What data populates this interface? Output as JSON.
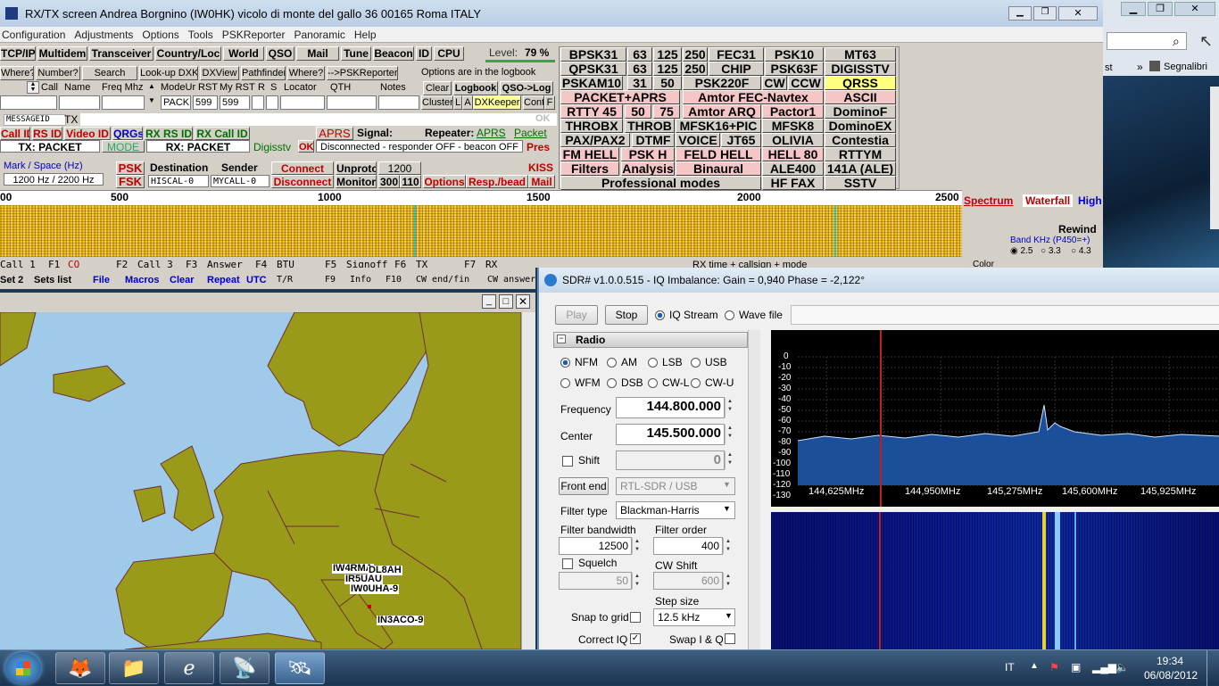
{
  "mixw": {
    "title": "RX/TX screen  Andrea Borgnino (IW0HK)     vicolo di monte del gallo 36     00165 Roma     ITALY",
    "menu": [
      "Configuration",
      "Adjustments",
      "Options",
      "Tools",
      "PSKReporter",
      "Panoramic",
      "Help"
    ],
    "toolbar1": [
      "TCP/IP",
      "Multidem",
      "Transceiver",
      "Country/Loc",
      "World",
      "QSO",
      "Mail",
      "Tune",
      "Beacon",
      "ID",
      "CPU"
    ],
    "level_label": "Level:",
    "level_value": "79 %",
    "toolbar2": [
      "Where?",
      "Number?",
      "Search",
      "Look-up DXK",
      "DXView",
      "Pathfinder",
      "Where?",
      "-->PSKReporter"
    ],
    "logbook_note": "Options are in the logbook",
    "log_headers": [
      "Call",
      "Name",
      "Freq Mhz",
      "ModeUr",
      "RST",
      "My RST",
      "R",
      "S",
      "Locator",
      "QTH",
      "Notes"
    ],
    "log_values": {
      "mode": "PACK",
      "rst": "599",
      "myrst": "599"
    },
    "log_buttons": {
      "clear": "Clear",
      "logbook": "Logbook",
      "qso_log": "QSO->Log",
      "cluster": "Cluster",
      "l": "L",
      "a": "A",
      "dxkeeper": "DXKeeper",
      "cont": "Cont",
      "f": "F"
    },
    "msg_field": "MESSAGEID",
    "tx_label": "TX",
    "ok_label": "OK",
    "id_row": [
      "Call ID",
      "RS ID",
      "Video ID",
      "QRGs",
      "RX RS ID",
      "RX Call ID",
      "APRS"
    ],
    "signal_label": "Signal:",
    "repeater_label": "Repeater:",
    "aprs_link": "APRS",
    "packet_link": "Packet",
    "tx_mode": "TX: PACKET",
    "mode_btn": "MODE",
    "rx_mode": "RX: PACKET",
    "digisstv": "Digisstv",
    "ok2": "OK",
    "status": "Disconnected - responder OFF - beacon OFF",
    "pres": "Pres",
    "mark_space_label": "Mark / Space (Hz)",
    "mark_space_value": "1200 Hz / 2200 Hz",
    "psk": "PSK",
    "fsk": "FSK",
    "dest_label": "Destination",
    "sender_label": "Sender",
    "dest_value": "HISCAL-0",
    "sender_value": "MYCALL-0",
    "connect": "Connect",
    "disconnect": "Disconnect",
    "unproto": "Unproto",
    "monitor": "Monitor",
    "baud": [
      "1200",
      "300",
      "110"
    ],
    "kiss": "KISS",
    "options": "Options",
    "resp_bead": "Resp./bead",
    "mail": "Mail",
    "modes": [
      [
        "BPSK31",
        "63",
        "125",
        "250",
        "FEC31",
        "PSK10",
        "MT63"
      ],
      [
        "QPSK31",
        "63",
        "125",
        "250",
        "CHIP",
        "PSK63F",
        "DIGISSTV"
      ],
      [
        "PSKAM10",
        "31",
        "50",
        "PSK220F",
        "CW",
        "CCW",
        "QRSS"
      ],
      [
        "PACKET+APRS",
        "Amtor FEC-Navtex",
        "ASCII"
      ],
      [
        "RTTY 45",
        "50",
        "75",
        "Amtor ARQ",
        "Pactor1",
        "DominoF"
      ],
      [
        "THROBX",
        "THROB",
        "MFSK16+PIC",
        "MFSK8",
        "DominoEX"
      ],
      [
        "PAX/PAX2",
        "DTMF",
        "VOICE",
        "JT65",
        "OLIVIA",
        "Contestia"
      ],
      [
        "FM HELL",
        "PSK H",
        "FELD HELL",
        "HELL 80",
        "RTTYM"
      ],
      [
        "Filters",
        "Analysis",
        "Binaural",
        "ALE400",
        "141A (ALE)"
      ],
      [
        "Professional modes",
        "HF FAX",
        "SSTV"
      ]
    ],
    "scale": [
      "00",
      "500",
      "1000",
      "1500",
      "2000",
      "2500"
    ],
    "spectrum": "Spectrum",
    "waterfall": "Waterfall",
    "high": "High",
    "rewind": "Rewind",
    "band_label": "Band KHz (P450=+)",
    "band_opts": [
      "2.5",
      "3.3",
      "4.3"
    ],
    "fkeys1": [
      "Call 1",
      "F1",
      "CQ",
      "F2",
      "Call 3",
      "F3",
      "Answer",
      "F4",
      "BTU",
      "F5",
      "Signoff",
      "F6",
      "TX",
      "F7",
      "RX"
    ],
    "fkeys2": [
      "Set 2",
      "Sets list",
      "File",
      "Macros",
      "Clear",
      "Repeat",
      "UTC",
      "T/R",
      "F9",
      "Info",
      "F10",
      "CW end/fin",
      "CW answer"
    ],
    "rx_time": "RX time + callsign + mode",
    "color": "Color"
  },
  "map": {
    "stations": [
      "IW4RMA",
      "DL8AH",
      "IR5UAU",
      "IW0UHA-9",
      "IN3ACO-9"
    ]
  },
  "sdr": {
    "title": "SDR# v1.0.0.515 - IQ Imbalance: Gain = 0,940 Phase = -2,122°",
    "play": "Play",
    "stop": "Stop",
    "iq_stream": "IQ Stream",
    "wave_file": "Wave file",
    "radio_header": "Radio",
    "modes": [
      "NFM",
      "AM",
      "LSB",
      "USB",
      "WFM",
      "DSB",
      "CW-L",
      "CW-U"
    ],
    "frequency_label": "Frequency",
    "frequency": "144.800.000",
    "center_label": "Center",
    "center": "145.500.000",
    "shift_label": "Shift",
    "shift": "0",
    "front_end": "Front end",
    "front_end_value": "RTL-SDR / USB",
    "filter_type_label": "Filter type",
    "filter_type": "Blackman-Harris",
    "filter_bw_label": "Filter bandwidth",
    "filter_bw": "12500",
    "filter_order_label": "Filter order",
    "filter_order": "400",
    "squelch_label": "Squelch",
    "squelch": "50",
    "cw_shift_label": "CW Shift",
    "cw_shift": "600",
    "step_label": "Step size",
    "step": "12.5 kHz",
    "snap_label": "Snap to grid",
    "correct_iq_label": "Correct IQ",
    "swap_label": "Swap I & Q",
    "y_ticks": [
      "0",
      "-10",
      "-20",
      "-30",
      "-40",
      "-50",
      "-60",
      "-70",
      "-80",
      "-90",
      "-100",
      "-110",
      "-120",
      "-130"
    ],
    "x_ticks": [
      "144,625MHz",
      "144,950MHz",
      "145,275MHz",
      "145,600MHz",
      "145,925MHz"
    ]
  },
  "taskbar": {
    "lang": "IT",
    "time": "19:34",
    "date": "06/08/2012"
  },
  "browser": {
    "bookmark": "Segnalibri"
  }
}
